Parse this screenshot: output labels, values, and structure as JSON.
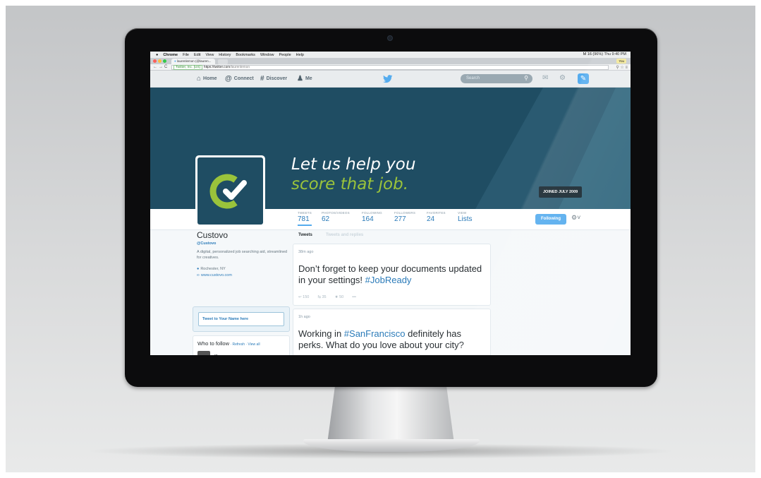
{
  "macbar": {
    "apple": "",
    "app": "Chrome",
    "menus": [
      "File",
      "Edit",
      "View",
      "History",
      "Bookmarks",
      "Window",
      "People",
      "Help"
    ],
    "status": "M 16  (96%)  Thu 9:40 PM"
  },
  "browser": {
    "tab_label": "laurenlemon (@lauren...",
    "you_badge": "You",
    "secure_label": "Twitter, Inc. [US]",
    "url_host": "https://twitter.com",
    "url_path": "/laurenlemon"
  },
  "twitter_nav": {
    "home": "Home",
    "connect": "Connect",
    "discover": "Discover",
    "me": "Me",
    "search_placeholder": "Search"
  },
  "header": {
    "tagline_line1": "Let us help you",
    "tagline_line2": "score that job.",
    "joined": "JOINED JULY 2009"
  },
  "stats": [
    {
      "label": "TWEETS",
      "value": "781"
    },
    {
      "label": "PHOTOS/VIDEOS",
      "value": "62"
    },
    {
      "label": "FOLLOWING",
      "value": "164"
    },
    {
      "label": "FOLLOWERS",
      "value": "277"
    },
    {
      "label": "FAVORITES",
      "value": "24"
    },
    {
      "label": "VIEW",
      "value": "Lists"
    }
  ],
  "follow_button": "Following",
  "profile": {
    "name": "Custovo",
    "handle": "@Custovo",
    "bio": "A digital, personalized job searching aid, streamlined for creatives.",
    "location": "Rochester, NY",
    "url": "www.custovo.com"
  },
  "tweet_to_placeholder": "Tweet to Your Name here",
  "who_to_follow": {
    "title": "Who to follow",
    "links": " · Refresh · View all",
    "first_name": "..."
  },
  "subtabs": {
    "tweets": "Tweets",
    "tweets_replies": "Tweets and replies"
  },
  "tweets": [
    {
      "time": "38m ago",
      "text_before": "Don’t forget to keep your documents updated in your settings! ",
      "hashtag": "#JobReady",
      "text_after": "",
      "replies": "150",
      "retweets": "35",
      "favorites": "50",
      "more": "•••"
    },
    {
      "time": "1h ago",
      "text_before": "Working in ",
      "hashtag": "#SanFrancisco",
      "text_after": " definitely has perks. What do you love about your city?",
      "replies": "",
      "retweets": "",
      "favorites": "",
      "more": ""
    }
  ],
  "colors": {
    "banner": "#1f4d63",
    "accent_green": "#9ac33b",
    "twitter_blue": "#55acee",
    "link_blue": "#2b7bb9"
  }
}
